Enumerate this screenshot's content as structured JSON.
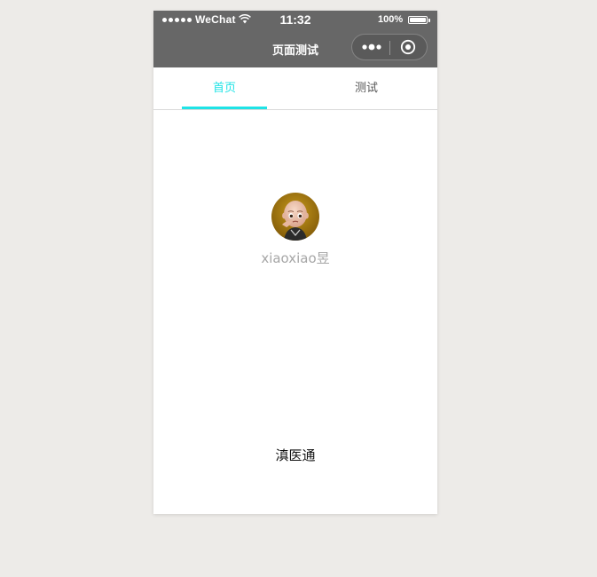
{
  "status_bar": {
    "carrier": "WeChat",
    "time": "11:32",
    "battery": "100%"
  },
  "nav": {
    "title": "页面测试"
  },
  "tabs": [
    {
      "label": "首页",
      "active": true
    },
    {
      "label": "测试",
      "active": false
    }
  ],
  "profile": {
    "username": "xiaoxiao昱"
  },
  "footer": {
    "text": "滇医通"
  },
  "colors": {
    "accent": "#1fe3e6",
    "nav_background": "#676767",
    "page_background": "#edebe8"
  },
  "icons": [
    "signal-icon",
    "wifi-icon",
    "battery-icon",
    "more-icon",
    "close-icon",
    "avatar"
  ]
}
